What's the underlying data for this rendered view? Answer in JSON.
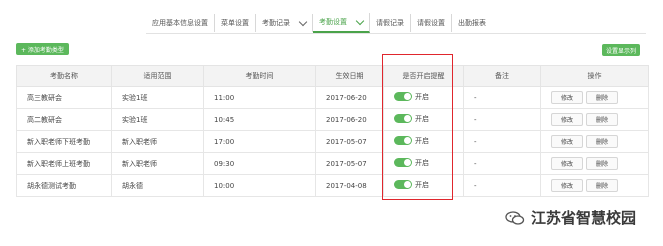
{
  "top_nav": {
    "tabs": [
      {
        "label": "应用基本信息设置",
        "dropdown": false,
        "active": false
      },
      {
        "label": "菜单设置",
        "dropdown": false,
        "active": false
      },
      {
        "label": "考勤记录",
        "dropdown": true,
        "active": false
      },
      {
        "label": "考勤设置",
        "dropdown": true,
        "active": true
      },
      {
        "label": "请假记录",
        "dropdown": false,
        "active": false
      },
      {
        "label": "请假设置",
        "dropdown": false,
        "active": false
      },
      {
        "label": "出勤报表",
        "dropdown": false,
        "active": false
      }
    ]
  },
  "toolbar": {
    "add_label": "+ 添加考勤类型",
    "demo_label": "设置显示列"
  },
  "table": {
    "headers": [
      "考勤名称",
      "适用范围",
      "考勤时间",
      "生效日期",
      "是否开启提醒",
      "备注",
      "操作"
    ],
    "rows": [
      {
        "name": "高三教研会",
        "scope": "实验1班",
        "time": "11:00",
        "date": "2017-06-20",
        "toggle": "开启",
        "note": "-"
      },
      {
        "name": "高二教研会",
        "scope": "实验1班",
        "time": "10:45",
        "date": "2017-06-20",
        "toggle": "开启",
        "note": "-"
      },
      {
        "name": "新入职老师下班考勤",
        "scope": "新入职老师",
        "time": "17:00",
        "date": "2017-05-07",
        "toggle": "开启",
        "note": "-"
      },
      {
        "name": "新入职老师上班考勤",
        "scope": "新入职老师",
        "time": "09:30",
        "date": "2017-05-07",
        "toggle": "开启",
        "note": "-"
      },
      {
        "name": "胡永德测试考勤",
        "scope": "胡永德",
        "time": "10:00",
        "date": "2017-04-08",
        "toggle": "开启",
        "note": "-"
      }
    ],
    "edit_label": "修改",
    "delete_label": "删除"
  },
  "watermark": {
    "text": "江苏省智慧校园"
  },
  "colors": {
    "accent": "#5cb85c",
    "highlight_box": "#e0262d"
  }
}
